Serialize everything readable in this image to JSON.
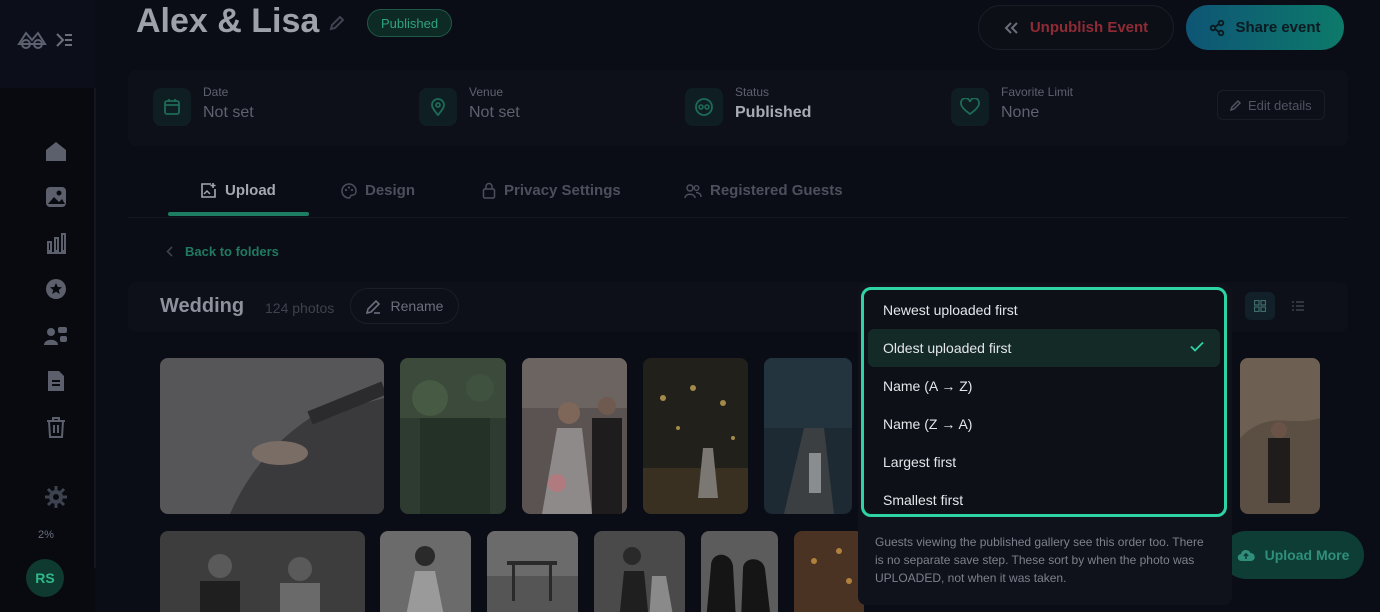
{
  "header": {
    "title": "Alex & Lisa",
    "status_badge": "Published",
    "unpublish_label": "Unpublish Event",
    "share_label": "Share event"
  },
  "sidebar": {
    "items": [
      "home-icon",
      "photos-icon",
      "analytics-icon",
      "star-icon",
      "guests-icon",
      "document-icon",
      "trash-icon",
      "settings-icon"
    ],
    "storage_percent": "2%",
    "avatar_initials": "RS"
  },
  "info": {
    "date_label": "Date",
    "date_value": "Not set",
    "venue_label": "Venue",
    "venue_value": "Not set",
    "status_label": "Status",
    "status_value": "Published",
    "favorite_label": "Favorite Limit",
    "favorite_value": "None",
    "edit_label": "Edit details"
  },
  "tabs": [
    {
      "label": "Upload",
      "active": true
    },
    {
      "label": "Design",
      "active": false
    },
    {
      "label": "Privacy Settings",
      "active": false
    },
    {
      "label": "Registered Guests",
      "active": false
    }
  ],
  "back_label": "Back to folders",
  "folder": {
    "name": "Wedding",
    "count": "124 photos",
    "rename_label": "Rename"
  },
  "sort_menu": {
    "options": [
      {
        "label": "Newest uploaded first",
        "selected": false
      },
      {
        "label": "Oldest uploaded first",
        "selected": true
      },
      {
        "label": "Name (A → Z)",
        "selected": false
      },
      {
        "label": "Name (Z → A)",
        "selected": false
      },
      {
        "label": "Largest first",
        "selected": false
      },
      {
        "label": "Smallest first",
        "selected": false
      }
    ],
    "note": "Guests viewing the published gallery see this order too. There is no separate save step. These sort by when the photo was UPLOADED, not when it was taken."
  },
  "upload_more_label": "Upload More",
  "colors": {
    "accent": "#2fd3a3",
    "danger": "#8f2b34",
    "share_gradient_start": "#0e5575",
    "share_gradient_end": "#0d7a6a"
  }
}
